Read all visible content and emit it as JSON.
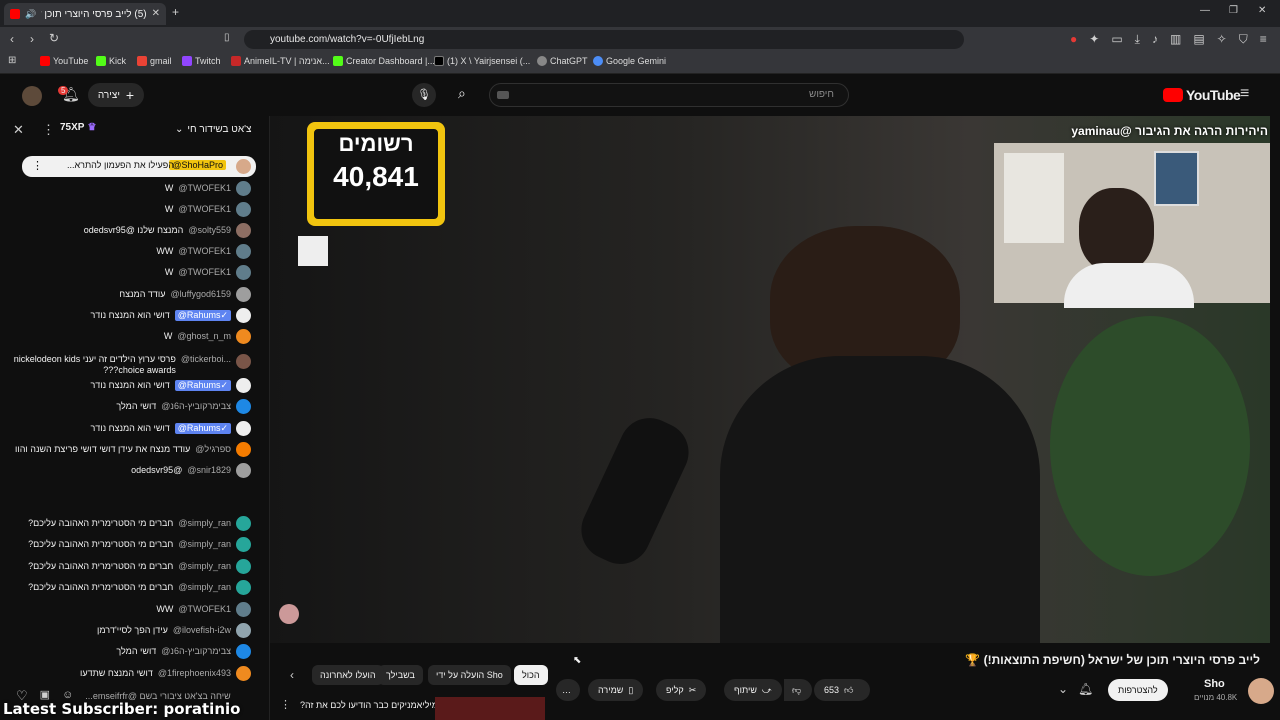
{
  "browser": {
    "tab_title": "(5) לייב פרסי היוצרי תוכן של",
    "url": "youtube.com/watch?v=-0UfjIebLng",
    "bookmarks": [
      "YouTube",
      "Kick",
      "gmail",
      "Twitch",
      "AnimeIL-TV | אנימה...",
      "Creator Dashboard |...",
      "(1) X \\ Yairjsensei (...",
      "ChatGPT",
      "Google Gemini"
    ]
  },
  "yt": {
    "logo": "YouTube",
    "search_placeholder": "חיפוש",
    "create_label": "יצירה",
    "notif_count": "5"
  },
  "chat": {
    "title": "צ'אט בשידור חי",
    "xp": "75XP",
    "pinned": {
      "author": "@ShoHaPro",
      "text": "הפעילו את הפעמון להתרא..."
    },
    "messages": [
      {
        "author": "@TWOFEK1",
        "text": "W",
        "mod": false,
        "color": "#607d8b"
      },
      {
        "author": "@TWOFEK1",
        "text": "W",
        "mod": false,
        "color": "#607d8b"
      },
      {
        "author": "@solty559",
        "text": "המנצח שלנו @odedsvr95",
        "mod": false,
        "color": "#8d6e63"
      },
      {
        "author": "@TWOFEK1",
        "text": "WW",
        "mod": false,
        "color": "#607d8b"
      },
      {
        "author": "@TWOFEK1",
        "text": "W",
        "mod": false,
        "color": "#607d8b"
      },
      {
        "author": "@luffygod6159",
        "text": "עודד המנצח",
        "mod": false,
        "color": "#9e9e9e"
      },
      {
        "author": "@Rahums✓",
        "text": "דושי הוא המנצח נודר",
        "mod": true,
        "color": "#eeeeee"
      },
      {
        "author": "@ghost_n_m",
        "text": "W",
        "mod": false,
        "color": "#ef8a1f"
      },
      {
        "author": "@tickerboi...",
        "text": "פרסי ערוץ הילדים זה יעני nickelodeon kids choice awards???",
        "mod": false,
        "color": "#795548"
      },
      {
        "author": "@Rahums✓",
        "text": "דושי הוא המנצח נודר",
        "mod": true,
        "color": "#eeeeee"
      },
      {
        "author": "@צבימרקוביץ-ה6נ",
        "text": "דושי המלך",
        "mod": false,
        "color": "#1e88e5"
      },
      {
        "author": "@Rahums✓",
        "text": "דושי הוא המנצח נודר",
        "mod": true,
        "color": "#eeeeee"
      },
      {
        "author": "@ספרגיל",
        "text": "עודד מנצח את עידן דושי דושי פריצת השנה והוו",
        "mod": false,
        "color": "#f57c00"
      },
      {
        "author": "@snir1829",
        "text": "@odedsvr95",
        "mod": false,
        "color": "#9e9e9e"
      },
      {
        "author": "@simply_ran",
        "text": "חברים מי הסטרימרית האהובה עליכם?",
        "mod": false,
        "color": "#26a69a"
      },
      {
        "author": "@simply_ran",
        "text": "חברים מי הסטרימרית האהובה עליכם?",
        "mod": false,
        "color": "#26a69a"
      },
      {
        "author": "@simply_ran",
        "text": "חברים מי הסטרימרית האהובה עליכם?",
        "mod": false,
        "color": "#26a69a"
      },
      {
        "author": "@simply_ran",
        "text": "חברים מי הסטרימרית האהובה עליכם?",
        "mod": false,
        "color": "#26a69a"
      },
      {
        "author": "@TWOFEK1",
        "text": "WW",
        "mod": false,
        "color": "#607d8b"
      },
      {
        "author": "@ilovefish-i2w",
        "text": "עידן הפך לסיי'דרמן",
        "mod": false,
        "color": "#90a4ae"
      },
      {
        "author": "@צבימרקוביץ-ה6נ",
        "text": "דושי המלך",
        "mod": false,
        "color": "#1e88e5"
      },
      {
        "author": "@1firephoenix493",
        "text": "דושי המנצח שתדעו",
        "mod": false,
        "color": "#ef8a1f"
      }
    ],
    "input_placeholder": "שיחה בצ'אט ציבורי בשם @emseifrfr..."
  },
  "video": {
    "counter_label": "רשומים",
    "counter_value": "40,841",
    "overlay_text": "היהירות הרגה את הגיבור @yaminau"
  },
  "below": {
    "title": "לייב פרסי היוצרי תוכן של ישראל (חשיפת התוצאות!) 🏆",
    "channel": "Sho",
    "subs": "40.8K מנויים",
    "subscribe": "להצטרפות",
    "likes": "653",
    "share": "שיתוף",
    "clip": "קליפ",
    "save": "שמירה",
    "chips": [
      "הכול",
      "הועלה על ידי Sho",
      "בשבילך",
      "הועלו לאחרונה"
    ],
    "next_video": "מיליאמניקים כבר הודיעו לכם את זה?",
    "latest_sub": "Latest Subscriber: poratinio"
  }
}
